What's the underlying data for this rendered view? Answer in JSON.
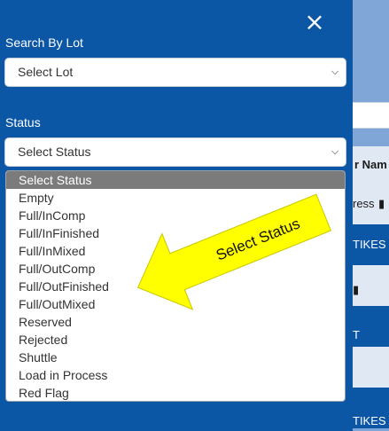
{
  "background": {
    "header_fragment": "r Nam",
    "row_fragments": [
      "ress",
      "TIKES",
      "",
      "T",
      "",
      "TIKES"
    ]
  },
  "panel": {
    "close_icon": "×",
    "lot_label": "Search By Lot",
    "lot_select": "Select Lot",
    "status_label": "Status",
    "status_select": "Select Status",
    "status_options": [
      "Select Status",
      "Empty",
      "Full/InComp",
      "Full/InFinished",
      "Full/InMixed",
      "Full/OutComp",
      "Full/OutFinished",
      "Full/OutMixed",
      "Reserved",
      "Rejected",
      "Shuttle",
      "Load in Process",
      "Red Flag"
    ],
    "selected_index": 0
  },
  "annotation": {
    "text": "Select Status",
    "color": "#ffff00"
  }
}
